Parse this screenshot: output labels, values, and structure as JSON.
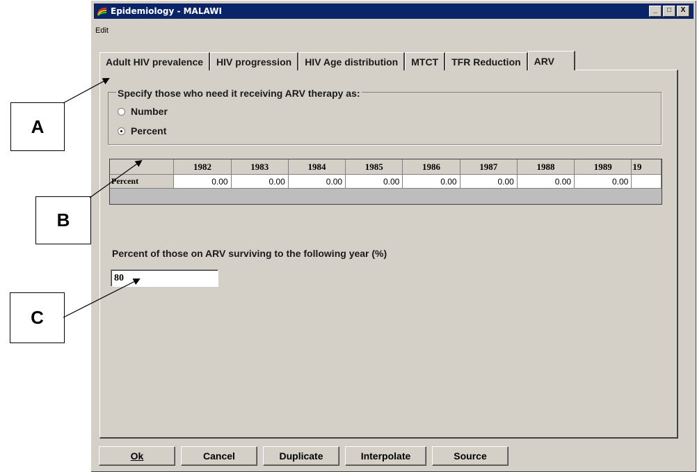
{
  "window": {
    "title": "Epidemiology - MALAWI",
    "controls": [
      "_",
      "□",
      "X"
    ]
  },
  "menubar": {
    "edit_label": "Edit"
  },
  "tabs": [
    {
      "label": "Adult HIV prevalence"
    },
    {
      "label": "HIV progression"
    },
    {
      "label": "HIV Age distribution"
    },
    {
      "label": "MTCT"
    },
    {
      "label": "TFR Reduction"
    },
    {
      "label": "ARV"
    }
  ],
  "active_tab": "ARV",
  "group": {
    "legend": "Specify those who need it receiving ARV therapy as:",
    "options": [
      {
        "label": "Number",
        "checked": false
      },
      {
        "label": "Percent",
        "checked": true
      }
    ]
  },
  "grid": {
    "years": [
      "1982",
      "1983",
      "1984",
      "1985",
      "1986",
      "1987",
      "1988",
      "1989",
      "19"
    ],
    "row_label": "Percent",
    "values": [
      "0.00",
      "0.00",
      "0.00",
      "0.00",
      "0.00",
      "0.00",
      "0.00",
      "0.00",
      ""
    ]
  },
  "survival": {
    "label": "Percent of those on ARV surviving to the following year (%)",
    "value": "80"
  },
  "buttons": {
    "ok": "Ok",
    "cancel": "Cancel",
    "duplicate": "Duplicate",
    "interpolate": "Interpolate",
    "source": "Source"
  },
  "callouts": {
    "a": "A",
    "b": "B",
    "c": "C"
  }
}
